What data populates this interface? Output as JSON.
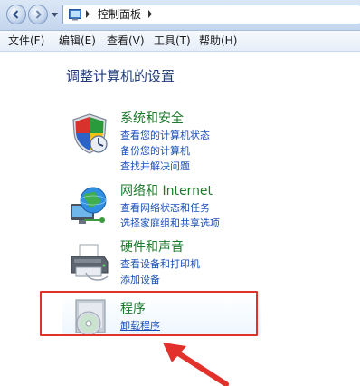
{
  "address_bar": {
    "breadcrumb": "控制面板"
  },
  "menu": [
    {
      "label": "文件(F)"
    },
    {
      "label": "编辑(E)"
    },
    {
      "label": "查看(V)"
    },
    {
      "label": "工具(T)"
    },
    {
      "label": "帮助(H)"
    }
  ],
  "main": {
    "title": "调整计算机的设置",
    "categories": [
      {
        "title": "系统和安全",
        "icon": "shield-icon",
        "links": [
          "查看您的计算机状态",
          "备份您的计算机",
          "查找并解决问题"
        ]
      },
      {
        "title": "网络和 Internet",
        "icon": "network-globe-icon",
        "links": [
          "查看网络状态和任务",
          "选择家庭组和共享选项"
        ]
      },
      {
        "title": "硬件和声音",
        "icon": "printer-icon",
        "links": [
          "查看设备和打印机",
          "添加设备"
        ]
      },
      {
        "title": "程序",
        "icon": "programs-disc-icon",
        "links": [
          "卸载程序"
        ]
      }
    ]
  },
  "colors": {
    "category_title": "#1b7a2b",
    "link": "#1a4fb8",
    "page_title": "#1f3a7a",
    "annotation": "#e2302b"
  }
}
